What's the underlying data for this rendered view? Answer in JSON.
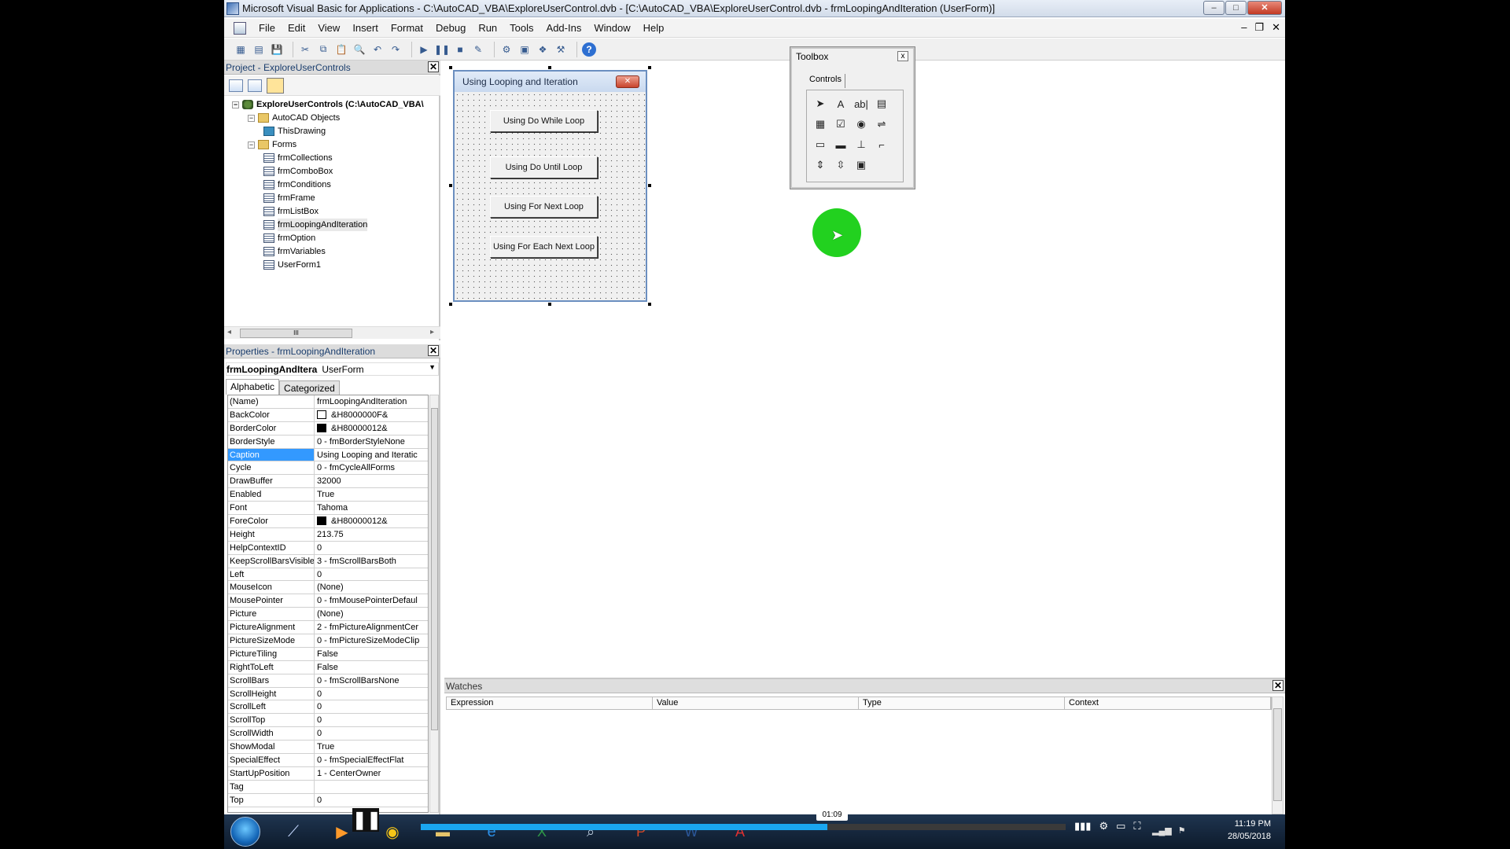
{
  "window": {
    "title": "Microsoft Visual Basic for Applications - C:\\AutoCAD_VBA\\ExploreUserControl.dvb - [C:\\AutoCAD_VBA\\ExploreUserControl.dvb - frmLoopingAndIteration (UserForm)]",
    "min": "–",
    "max": "□",
    "close": "✕"
  },
  "menu": {
    "items": [
      "File",
      "Edit",
      "View",
      "Insert",
      "Format",
      "Debug",
      "Run",
      "Tools",
      "Add-Ins",
      "Window",
      "Help"
    ],
    "mdi_min": "–",
    "mdi_restore": "❐",
    "mdi_close": "✕"
  },
  "toolbar": {
    "icons": [
      "view-excel-icon",
      "insert-userform-icon",
      "save-icon",
      "cut-icon",
      "copy-icon",
      "paste-icon",
      "find-icon",
      "undo-icon",
      "redo-icon",
      "run-icon",
      "break-icon",
      "reset-icon",
      "design-mode-icon",
      "project-explorer-icon",
      "properties-icon",
      "object-browser-icon",
      "toolbox-icon",
      "help-icon"
    ]
  },
  "project": {
    "title": "Project - ExploreUserControls",
    "close": "✕",
    "tree": [
      {
        "label": "ExploreUserControls (C:\\AutoCAD_VBA\\",
        "level": 0,
        "icon": "project",
        "expander": "−",
        "bold": true
      },
      {
        "label": "AutoCAD Objects",
        "level": 1,
        "icon": "folder",
        "expander": "−"
      },
      {
        "label": "ThisDrawing",
        "level": 2,
        "icon": "drawing"
      },
      {
        "label": "Forms",
        "level": 1,
        "icon": "folder",
        "expander": "−"
      },
      {
        "label": "frmCollections",
        "level": 2,
        "icon": "form"
      },
      {
        "label": "frmComboBox",
        "level": 2,
        "icon": "form"
      },
      {
        "label": "frmConditions",
        "level": 2,
        "icon": "form"
      },
      {
        "label": "frmFrame",
        "level": 2,
        "icon": "form"
      },
      {
        "label": "frmListBox",
        "level": 2,
        "icon": "form"
      },
      {
        "label": "frmLoopingAndIteration",
        "level": 2,
        "icon": "form",
        "selected": true
      },
      {
        "label": "frmOption",
        "level": 2,
        "icon": "form"
      },
      {
        "label": "frmVariables",
        "level": 2,
        "icon": "form"
      },
      {
        "label": "UserForm1",
        "level": 2,
        "icon": "form"
      }
    ],
    "hscroll_thumb": "III"
  },
  "properties": {
    "title": "Properties - frmLoopingAndIteration",
    "close": "✕",
    "object_name": "frmLoopingAndItera",
    "object_type": "UserForm",
    "tabs": [
      "Alphabetic",
      "Categorized"
    ],
    "rows": [
      {
        "name": "(Name)",
        "value": "frmLoopingAndIteration"
      },
      {
        "name": "BackColor",
        "value": "&H8000000F&",
        "swatch": "#ffffff"
      },
      {
        "name": "BorderColor",
        "value": "&H80000012&",
        "swatch": "#000000"
      },
      {
        "name": "BorderStyle",
        "value": "0 - fmBorderStyleNone"
      },
      {
        "name": "Caption",
        "value": "Using Looping and Iteratic",
        "selected": true
      },
      {
        "name": "Cycle",
        "value": "0 - fmCycleAllForms"
      },
      {
        "name": "DrawBuffer",
        "value": "32000"
      },
      {
        "name": "Enabled",
        "value": "True"
      },
      {
        "name": "Font",
        "value": "Tahoma"
      },
      {
        "name": "ForeColor",
        "value": "&H80000012&",
        "swatch": "#000000"
      },
      {
        "name": "Height",
        "value": "213.75"
      },
      {
        "name": "HelpContextID",
        "value": "0"
      },
      {
        "name": "KeepScrollBarsVisible",
        "value": "3 - fmScrollBarsBoth"
      },
      {
        "name": "Left",
        "value": "0"
      },
      {
        "name": "MouseIcon",
        "value": "(None)"
      },
      {
        "name": "MousePointer",
        "value": "0 - fmMousePointerDefaul"
      },
      {
        "name": "Picture",
        "value": "(None)"
      },
      {
        "name": "PictureAlignment",
        "value": "2 - fmPictureAlignmentCer"
      },
      {
        "name": "PictureSizeMode",
        "value": "0 - fmPictureSizeModeClip"
      },
      {
        "name": "PictureTiling",
        "value": "False"
      },
      {
        "name": "RightToLeft",
        "value": "False"
      },
      {
        "name": "ScrollBars",
        "value": "0 - fmScrollBarsNone"
      },
      {
        "name": "ScrollHeight",
        "value": "0"
      },
      {
        "name": "ScrollLeft",
        "value": "0"
      },
      {
        "name": "ScrollTop",
        "value": "0"
      },
      {
        "name": "ScrollWidth",
        "value": "0"
      },
      {
        "name": "ShowModal",
        "value": "True"
      },
      {
        "name": "SpecialEffect",
        "value": "0 - fmSpecialEffectFlat"
      },
      {
        "name": "StartUpPosition",
        "value": "1 - CenterOwner"
      },
      {
        "name": "Tag",
        "value": ""
      },
      {
        "name": "Top",
        "value": "0"
      }
    ]
  },
  "userform": {
    "caption": "Using Looping and Iteration",
    "close": "✕",
    "buttons": [
      "Using Do While Loop",
      "Using Do Until Loop",
      "Using For Next Loop",
      "Using For Each Next Loop"
    ]
  },
  "toolbox": {
    "title": "Toolbox",
    "close": "x",
    "tab": "Controls",
    "tools": [
      {
        "icon": "select-objects-icon",
        "glyph": "➤"
      },
      {
        "icon": "label-icon",
        "glyph": "A"
      },
      {
        "icon": "textbox-icon",
        "glyph": "ab|"
      },
      {
        "icon": "combobox-icon",
        "glyph": "▤"
      },
      {
        "icon": "listbox-icon",
        "glyph": "▦"
      },
      {
        "icon": "checkbox-icon",
        "glyph": "☑"
      },
      {
        "icon": "optionbutton-icon",
        "glyph": "◉"
      },
      {
        "icon": "togglebutton-icon",
        "glyph": "⇌"
      },
      {
        "icon": "frame-icon",
        "glyph": "▭"
      },
      {
        "icon": "commandbutton-icon",
        "glyph": "▬"
      },
      {
        "icon": "tabstrip-icon",
        "glyph": "⊥"
      },
      {
        "icon": "multipage-icon",
        "glyph": "⌐"
      },
      {
        "icon": "scrollbar-icon",
        "glyph": "⇕"
      },
      {
        "icon": "spinbutton-icon",
        "glyph": "⇳"
      },
      {
        "icon": "image-icon",
        "glyph": "▣"
      }
    ]
  },
  "watches": {
    "title": "Watches",
    "close": "✕",
    "columns": [
      "Expression",
      "Value",
      "Type",
      "Context"
    ]
  },
  "video": {
    "pause": "❚❚",
    "time": "01:09",
    "progress": 0.63
  },
  "taskbar": {
    "apps": [
      "autocad-icon",
      "media-player-icon",
      "chrome-icon",
      "explorer-icon",
      "ie-icon",
      "excel-icon",
      "search-icon",
      "powerpoint-icon",
      "word-icon",
      "acrobat-icon"
    ],
    "time": "11:19 PM",
    "date": "28/05/2018"
  }
}
